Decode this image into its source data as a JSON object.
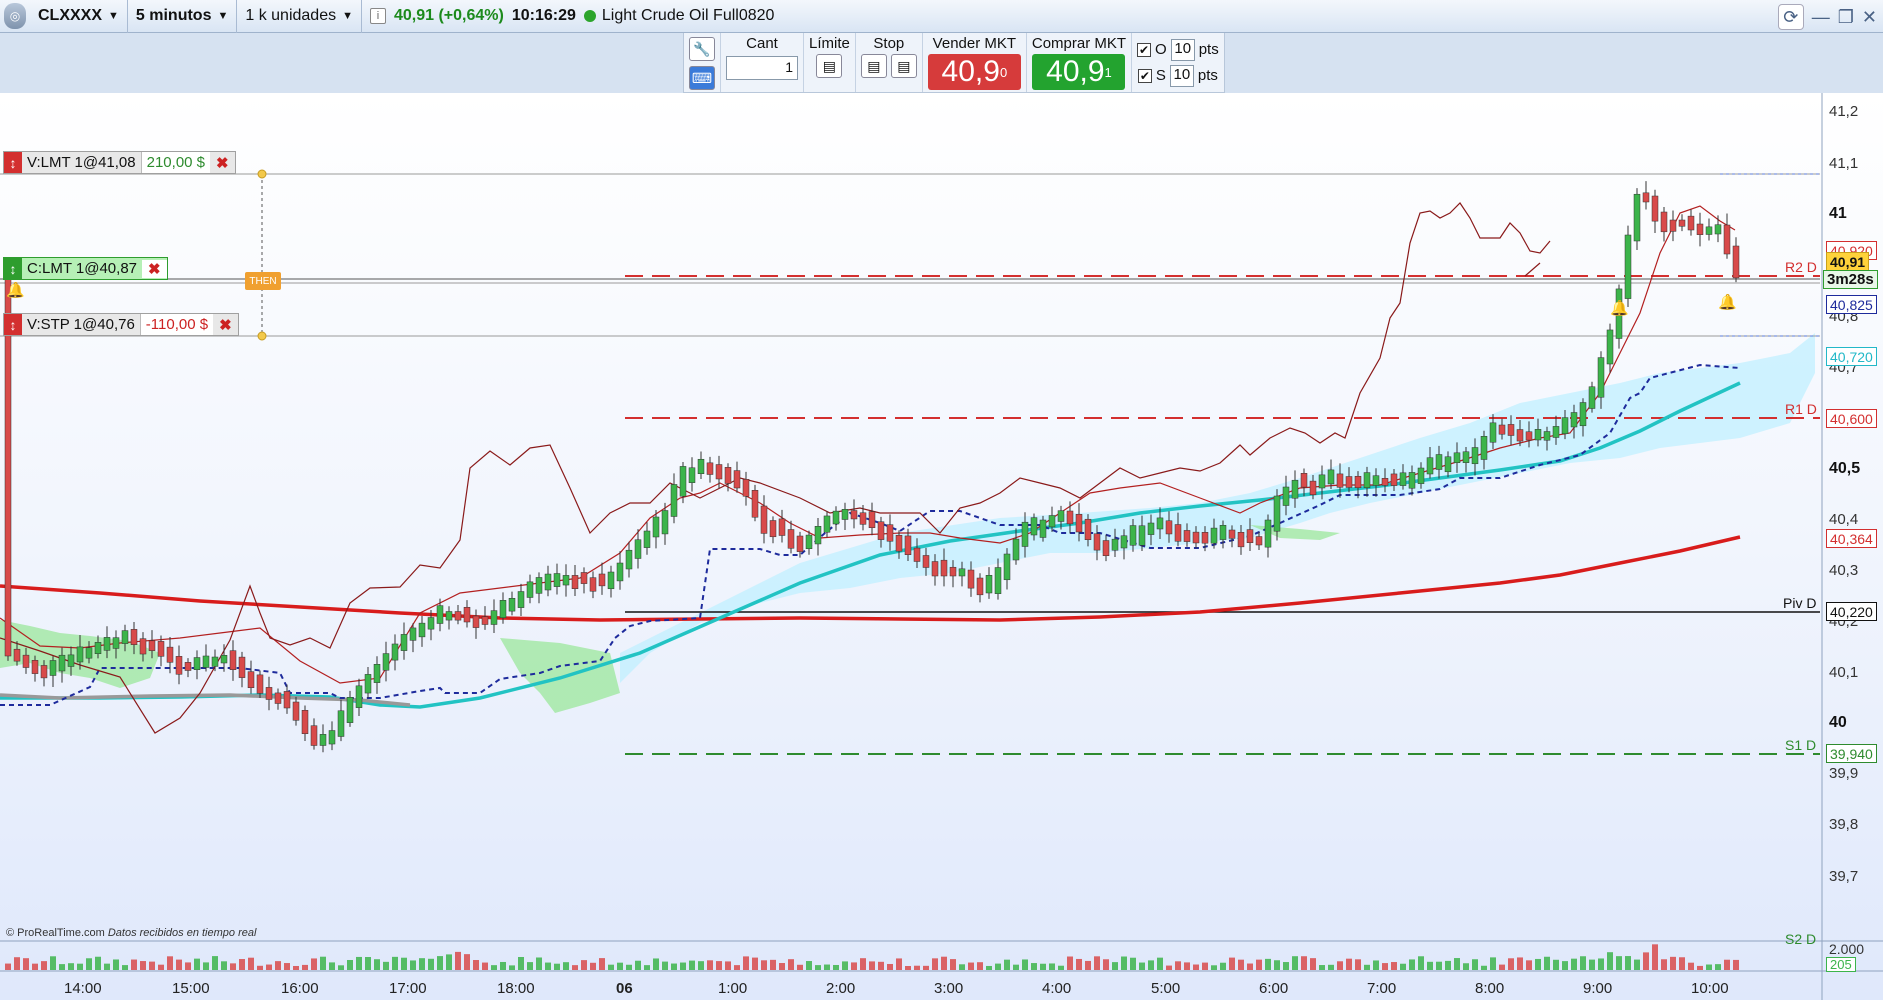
{
  "topbar": {
    "instrument": "CLXXXX",
    "timeframe": "5 minutos",
    "units": "1 k unidades",
    "info_icon": "i",
    "price_change": "40,91 (+0,64%)",
    "time": "10:16:29",
    "description": "Light Crude Oil Full0820"
  },
  "order_toolbar": {
    "qty_label": "Cant",
    "qty_value": "1",
    "limit_label": "Límite",
    "stop_label": "Stop",
    "sell_label": "Vender MKT",
    "sell_price": "40,9",
    "sell_sup": "0",
    "buy_label": "Comprar MKT",
    "buy_price": "40,9",
    "buy_sup": "1",
    "o_label": "O",
    "o_value": "10",
    "s_label": "S",
    "s_value": "10",
    "pts_label": "pts"
  },
  "orders": [
    {
      "label": "V:LMT 1@41,08",
      "pnl": "210,00 $",
      "color": "#d32f2f"
    },
    {
      "label": "C:LMT 1@40,87",
      "pnl": "",
      "color": "#2e9d2e"
    },
    {
      "label": "V:STP 1@40,76",
      "pnl": "-110,00 $",
      "color": "#d32f2f"
    }
  ],
  "then_label": "THEN",
  "levels": {
    "r2": "R2 D",
    "r1": "R1 D",
    "piv": "Piv D",
    "s1": "S1 D",
    "s2": "S2 D"
  },
  "axis": {
    "ticks": [
      "41,2",
      "41,1",
      "41",
      "40,9",
      "40,8",
      "40,7",
      "40,6",
      "40,5",
      "40,4",
      "40,3",
      "40,2",
      "40,1",
      "40",
      "39,9",
      "39,8",
      "39,7"
    ],
    "price_boxes": {
      "current": "40,91",
      "ask": "40,920",
      "countdown": "3m28s",
      "blue": "40,825",
      "cyan": "40,720",
      "r1": "40,600",
      "red_ma": "40,364",
      "piv": "40,220",
      "s1": "39,940"
    }
  },
  "volume_axis": {
    "max": "2.000",
    "last": "205"
  },
  "time_axis": [
    "14:00",
    "15:00",
    "16:00",
    "17:00",
    "18:00",
    "06",
    "1:00",
    "2:00",
    "3:00",
    "4:00",
    "5:00",
    "6:00",
    "7:00",
    "8:00",
    "9:00",
    "10:00"
  ],
  "credits": {
    "source": "© ProRealTime.com",
    "status": "Datos recibidos en tiempo real"
  },
  "colors": {
    "up": "#3cb44b",
    "down": "#d84a4a",
    "r_level": "#d32f2f",
    "s_level": "#2e8b2e",
    "ma_slow": "#d81c1c",
    "ma_fast": "#22c3c3",
    "trail": "#1e2b9c"
  }
}
